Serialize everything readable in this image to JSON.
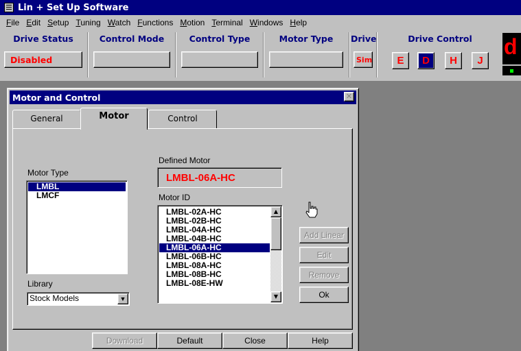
{
  "app": {
    "title": "Lin + Set Up Software"
  },
  "menu": [
    "File",
    "Edit",
    "Setup",
    "Tuning",
    "Watch",
    "Functions",
    "Motion",
    "Terminal",
    "Windows",
    "Help"
  ],
  "status": {
    "drive_status_label": "Drive Status",
    "drive_status_value": "Disabled",
    "control_mode_label": "Control Mode",
    "control_mode_value": "",
    "control_type_label": "Control Type",
    "control_type_value": "",
    "motor_type_label": "Motor Type",
    "motor_type_value": "",
    "drive_label": "Drive",
    "drive_value": "Sim",
    "drive_control_label": "Drive Control",
    "drive_control_buttons": [
      "E",
      "D",
      "H",
      "J"
    ],
    "drive_control_active": "D",
    "indicator": "d"
  },
  "dialog": {
    "title": "Motor and Control",
    "tabs": [
      "General",
      "Motor",
      "Control"
    ],
    "active_tab": "Motor",
    "motor_type_label": "Motor Type",
    "motor_types": [
      "LMBL",
      "LMCF"
    ],
    "selected_motor_type": "LMBL",
    "defined_motor_label": "Defined Motor",
    "defined_motor_value": "LMBL-06A-HC",
    "motor_id_label": "Motor ID",
    "motor_ids": [
      "LMBL-02A-HC",
      "LMBL-02B-HC",
      "LMBL-04A-HC",
      "LMBL-04B-HC",
      "LMBL-06A-HC",
      "LMBL-06B-HC",
      "LMBL-08A-HC",
      "LMBL-08B-HC",
      "LMBL-08E-HW"
    ],
    "selected_motor_id": "LMBL-06A-HC",
    "side_buttons": {
      "add_linear": "Add Linear",
      "edit": "Edit",
      "remove": "Remove",
      "ok": "Ok"
    },
    "library_label": "Library",
    "library_value": "Stock Models",
    "bottom_buttons": {
      "download": "Download",
      "default": "Default",
      "close": "Close",
      "help": "Help"
    }
  },
  "colors": {
    "titlebar": "#000080",
    "face": "#c0c0c0",
    "desktop": "#808080",
    "alert_red": "#ff0000",
    "led_green": "#00ff00"
  }
}
